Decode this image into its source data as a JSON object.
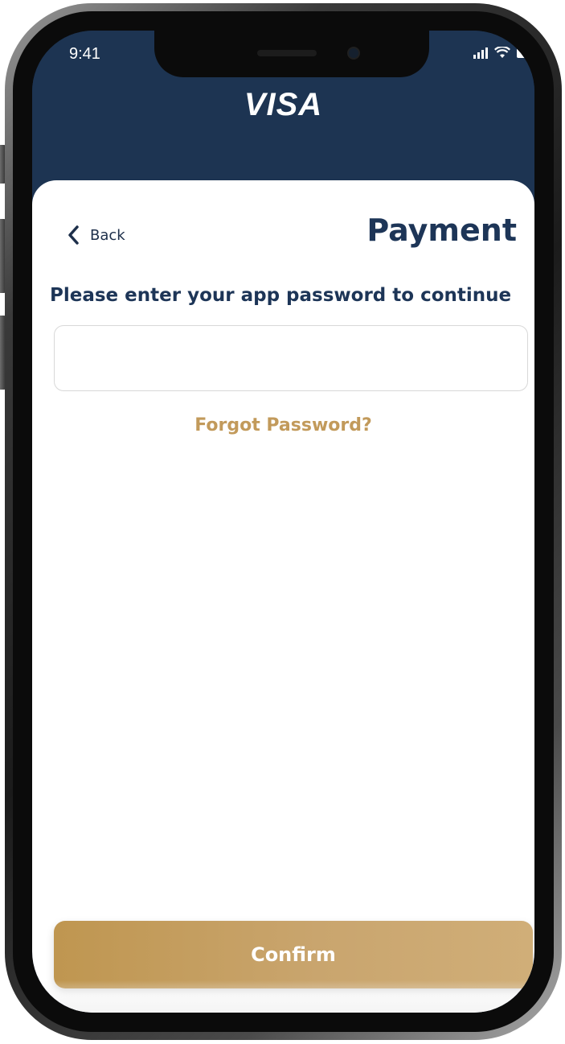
{
  "status_bar": {
    "time": "9:41"
  },
  "header": {
    "brand": "VISA",
    "background_color": "#1d3452"
  },
  "nav": {
    "back_label": "Back",
    "page_title": "Payment"
  },
  "form": {
    "prompt": "Please enter your app password to continue",
    "password_value": "",
    "password_placeholder": "",
    "forgot_link": "Forgot Password?",
    "confirm_label": "Confirm"
  },
  "icons": {
    "back": "chevron-left-icon",
    "signal": "signal-icon",
    "wifi": "wifi-icon",
    "battery": "battery-icon"
  },
  "colors": {
    "navy": "#1d3557",
    "gold": "#c29a5b",
    "button_gold": "#c9a56e"
  }
}
